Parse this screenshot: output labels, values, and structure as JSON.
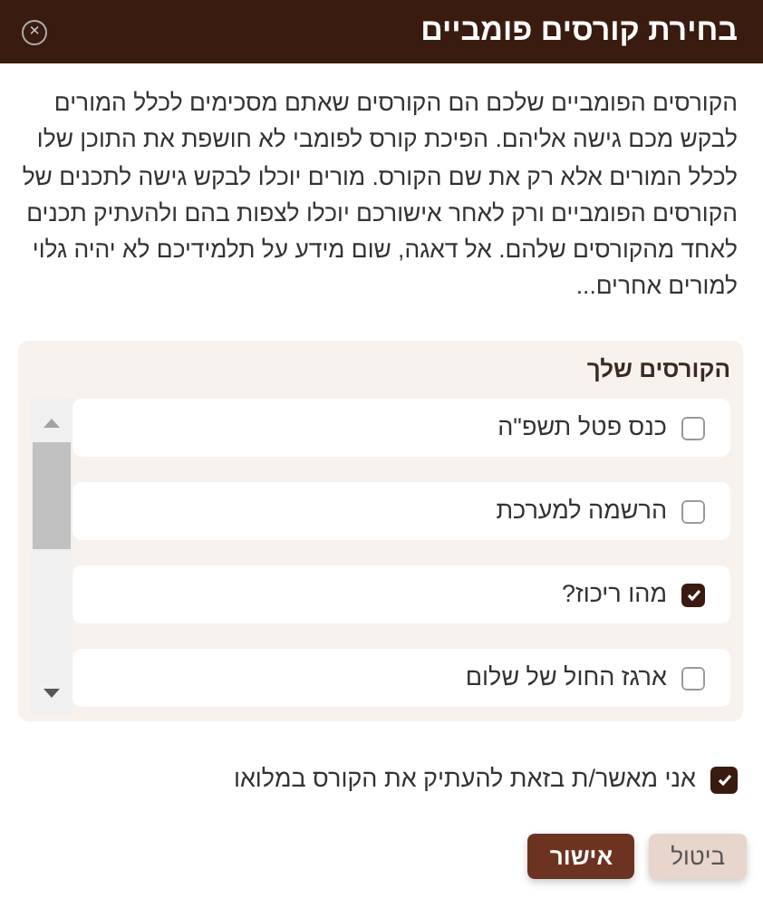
{
  "dialog": {
    "title": "בחירת קורסים פומביים",
    "close_icon": "×"
  },
  "description": "הקורסים הפומביים שלכם הם הקורסים שאתם מסכימים לכלל המורים לבקש מכם גישה אליהם. הפיכת קורס לפומבי לא חושפת את התוכן שלו לכלל המורים אלא רק את שם הקורס. מורים יוכלו לבקש גישה לתכנים של הקורסים הפומביים ורק לאחר אישורכם יוכלו לצפות בהם ולהעתיק תכנים לאחד מהקורסים שלהם. אל דאגה, שום מידע על תלמידיכם לא יהיה גלוי למורים אחרים...",
  "courses_panel": {
    "title": "הקורסים שלך",
    "items": [
      {
        "label": "כנס פטל תשפ\"ה",
        "checked": false
      },
      {
        "label": "הרשמה למערכת",
        "checked": false
      },
      {
        "label": "מהו ריכוז?",
        "checked": true
      },
      {
        "label": "ארגז החול של שלום",
        "checked": false
      }
    ]
  },
  "confirm": {
    "label": "אני מאשר/ת בזאת להעתיק את הקורס במלואו",
    "checked": true
  },
  "buttons": [
    {
      "label": "ביטול",
      "kind": "secondary"
    },
    {
      "label": "אישור",
      "kind": "primary"
    }
  ]
}
